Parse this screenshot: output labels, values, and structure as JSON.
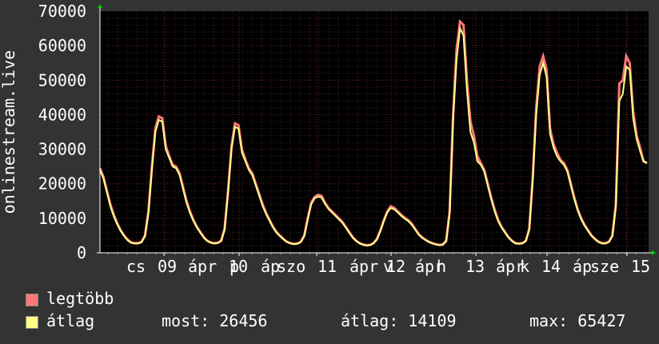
{
  "chart_data": {
    "type": "area",
    "ylabel": "onlinestream.live",
    "yticks": [
      "0",
      "10000",
      "20000",
      "30000",
      "40000",
      "50000",
      "60000",
      "70000"
    ],
    "ylim": [
      0,
      70000
    ],
    "x_tick_labels": [
      "cs 09 ápr",
      "p 10 ápr",
      "szo 11 ápr",
      "v 12 ápr",
      "h 13 ápr",
      "k 14 ápr",
      "sze 15"
    ],
    "x_tick_label_segments": [
      "cs",
      "09",
      "ápr",
      "p",
      "10",
      "áp",
      "szo",
      "11",
      "ápr",
      "v",
      "12",
      "ápr",
      "h",
      "13",
      "ápr",
      "k",
      "14",
      "áp",
      "sze",
      "15"
    ],
    "grid": true,
    "series": [
      {
        "name": "legtöbb",
        "color": "#ff7777",
        "values": [
          24500,
          22000,
          18000,
          14000,
          11000,
          8500,
          6500,
          5000,
          3800,
          3000,
          2800,
          2800,
          3200,
          5000,
          12000,
          25000,
          36000,
          39500,
          39000,
          31000,
          28000,
          25500,
          25000,
          23000,
          19000,
          15000,
          12000,
          9500,
          7500,
          6000,
          4500,
          3500,
          3000,
          2800,
          2900,
          3500,
          7000,
          18000,
          31000,
          37500,
          37000,
          30000,
          27000,
          24500,
          23000,
          20000,
          17000,
          14000,
          11500,
          9500,
          7500,
          6000,
          5000,
          4000,
          3200,
          2800,
          2600,
          2700,
          3200,
          5000,
          10000,
          14500,
          16200,
          16800,
          16500,
          14500,
          13000,
          12000,
          11000,
          10000,
          9000,
          7500,
          6000,
          4500,
          3500,
          2800,
          2400,
          2200,
          2300,
          2800,
          4000,
          6500,
          9500,
          12000,
          13500,
          13000,
          12000,
          11000,
          10200,
          9500,
          8500,
          7000,
          5500,
          4500,
          3800,
          3200,
          2800,
          2500,
          2300,
          2400,
          3500,
          12000,
          40000,
          59000,
          67000,
          66000,
          50000,
          38000,
          34000,
          28000,
          26000,
          24000,
          20000,
          16000,
          12500,
          9500,
          7500,
          6000,
          4500,
          3500,
          2800,
          2700,
          2800,
          3500,
          7000,
          22000,
          42000,
          54000,
          57000,
          53000,
          36000,
          31500,
          29000,
          27000,
          26000,
          24000,
          20000,
          16000,
          12500,
          10000,
          8000,
          6500,
          5000,
          4000,
          3200,
          2800,
          2800,
          3200,
          5000,
          14000,
          49000,
          50000,
          57000,
          55000,
          41000,
          34000,
          30500,
          26500,
          26000
        ]
      },
      {
        "name": "átlag",
        "color": "#ffff88",
        "values": [
          24000,
          21500,
          17500,
          13500,
          10500,
          8200,
          6300,
          4800,
          3600,
          2900,
          2700,
          2700,
          3000,
          4800,
          11500,
          24000,
          35000,
          38500,
          38000,
          30000,
          27500,
          25000,
          24500,
          22500,
          18500,
          14500,
          11500,
          9200,
          7300,
          5800,
          4400,
          3400,
          2900,
          2700,
          2800,
          3400,
          6700,
          17500,
          30000,
          36500,
          36000,
          29000,
          26500,
          24000,
          22500,
          19500,
          16500,
          13500,
          11200,
          9200,
          7300,
          5800,
          4800,
          3900,
          3100,
          2700,
          2500,
          2600,
          3100,
          4800,
          9600,
          14000,
          15800,
          16300,
          16000,
          14200,
          12700,
          11700,
          10700,
          9700,
          8700,
          7300,
          5800,
          4400,
          3400,
          2700,
          2300,
          2100,
          2200,
          2700,
          3900,
          6300,
          9200,
          11700,
          13000,
          12600,
          11700,
          10700,
          9900,
          9200,
          8200,
          6800,
          5300,
          4400,
          3700,
          3100,
          2700,
          2400,
          2200,
          2300,
          3300,
          11500,
          38500,
          56000,
          65000,
          63000,
          47000,
          35000,
          32000,
          26500,
          25500,
          23500,
          19500,
          15500,
          12000,
          9200,
          7300,
          5800,
          4400,
          3400,
          2700,
          2600,
          2700,
          3400,
          6700,
          21000,
          40000,
          51500,
          55000,
          51000,
          34500,
          30500,
          28000,
          26500,
          25500,
          23500,
          19500,
          15500,
          12200,
          9700,
          7800,
          6300,
          4900,
          3900,
          3100,
          2700,
          2700,
          3100,
          4800,
          13500,
          44000,
          46000,
          54000,
          53000,
          39000,
          33000,
          29500,
          26500,
          26000
        ]
      }
    ],
    "legend_position": "bottom-left"
  },
  "legend": {
    "max_label": "legtöbb",
    "avg_label": "átlag",
    "max_color": "#ff7777",
    "avg_color": "#ffff88"
  },
  "stats": {
    "now": "most: 26456",
    "avg": "átlag: 14109",
    "max": "max: 65427"
  }
}
